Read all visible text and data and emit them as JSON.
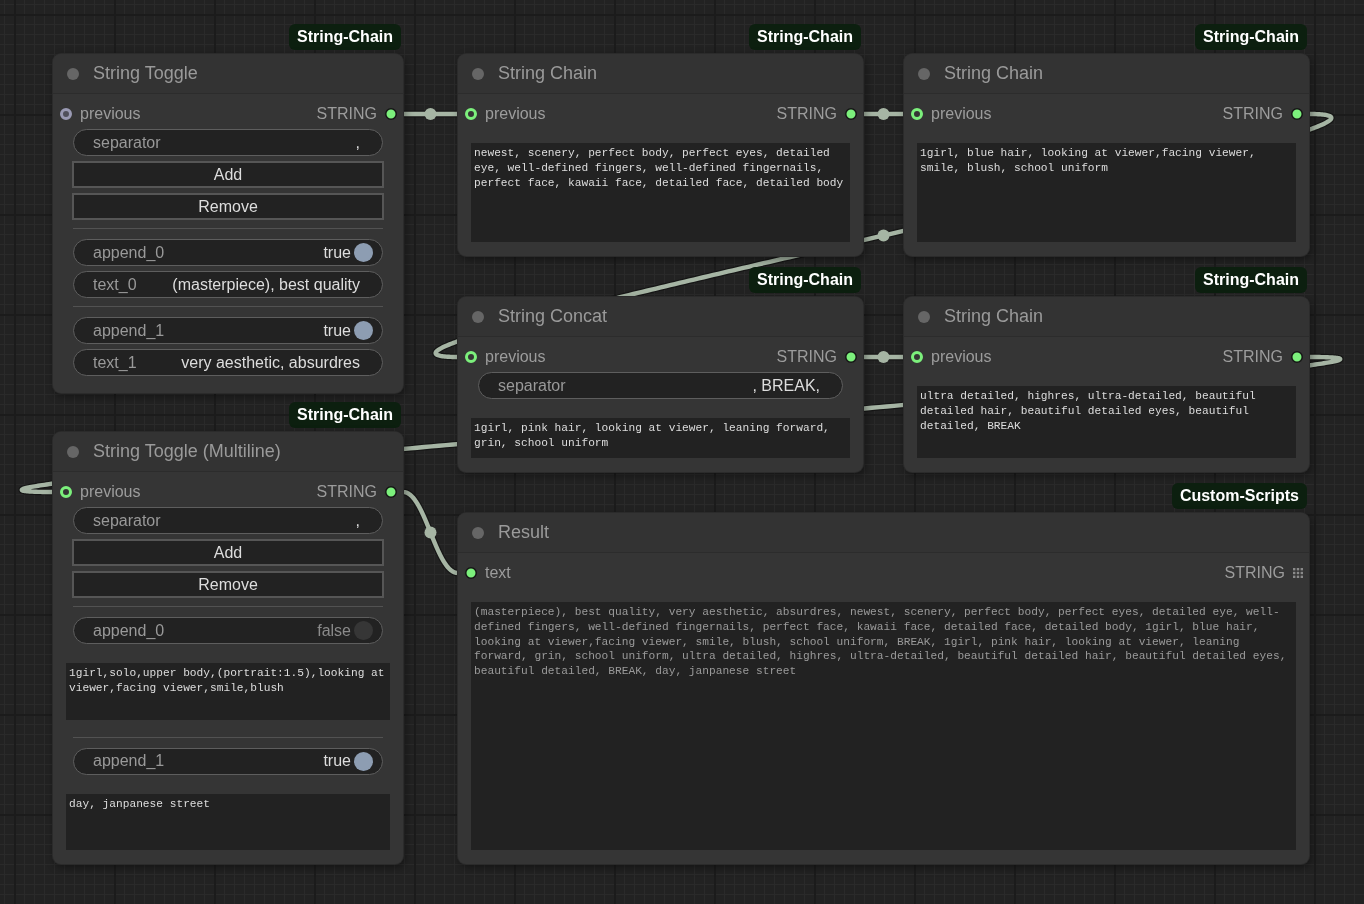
{
  "nodes": [
    {
      "badge": "String-Chain",
      "title": "String Toggle",
      "input": {
        "label": "previous",
        "hollow": true,
        "connected": false
      },
      "output": {
        "label": "STRING",
        "grid": false,
        "connected": true
      },
      "widgets": [
        {
          "kind": "text",
          "label": "separator",
          "value": ","
        },
        {
          "kind": "button",
          "label": "Add"
        },
        {
          "kind": "button",
          "label": "Remove"
        },
        {
          "kind": "divider"
        },
        {
          "kind": "toggle",
          "label": "append_0",
          "value": "true",
          "on": true
        },
        {
          "kind": "text",
          "label": "text_0",
          "value": "(masterpiece), best quality"
        },
        {
          "kind": "divider"
        },
        {
          "kind": "toggle",
          "label": "append_1",
          "value": "true",
          "on": true
        },
        {
          "kind": "text",
          "label": "text_1",
          "value": "very aesthetic, absurdres"
        }
      ]
    },
    {
      "badge": "String-Chain",
      "title": "String Chain",
      "input": {
        "label": "previous",
        "hollow": true,
        "connected": true
      },
      "output": {
        "label": "STRING",
        "grid": false,
        "connected": true
      },
      "widgets": [
        {
          "kind": "textarea",
          "value": "newest, scenery, perfect body, perfect eyes, detailed eye, well-defined fingers, well-defined fingernails, perfect face, kawaii face, detailed face, detailed body",
          "readonly": false
        }
      ]
    },
    {
      "badge": "String-Chain",
      "title": "String Chain",
      "input": {
        "label": "previous",
        "hollow": true,
        "connected": true
      },
      "output": {
        "label": "STRING",
        "grid": false,
        "connected": true
      },
      "widgets": [
        {
          "kind": "textarea",
          "value": "1girl, blue hair, looking at viewer,facing viewer, smile, blush, school uniform",
          "readonly": false
        }
      ]
    },
    {
      "badge": "String-Chain",
      "title": "String Concat",
      "input": {
        "label": "previous",
        "hollow": true,
        "connected": true
      },
      "output": {
        "label": "STRING",
        "grid": false,
        "connected": true
      },
      "widgets": [
        {
          "kind": "text",
          "label": "separator",
          "value": ", BREAK,"
        },
        {
          "kind": "textarea",
          "value": "1girl, pink hair, looking at viewer, leaning forward, grin, school uniform",
          "readonly": false
        }
      ]
    },
    {
      "badge": "String-Chain",
      "title": "String Chain",
      "input": {
        "label": "previous",
        "hollow": true,
        "connected": true
      },
      "output": {
        "label": "STRING",
        "grid": false,
        "connected": true
      },
      "widgets": [
        {
          "kind": "textarea",
          "value": "ultra detailed, highres, ultra-detailed, beautiful detailed hair, beautiful detailed eyes, beautiful detailed, BREAK",
          "readonly": false
        }
      ]
    },
    {
      "badge": "String-Chain",
      "title": "String Toggle (Multiline)",
      "input": {
        "label": "previous",
        "hollow": true,
        "connected": true
      },
      "output": {
        "label": "STRING",
        "grid": false,
        "connected": true
      },
      "widgets": [
        {
          "kind": "text",
          "label": "separator",
          "value": ","
        },
        {
          "kind": "button",
          "label": "Add"
        },
        {
          "kind": "button",
          "label": "Remove"
        },
        {
          "kind": "divider"
        },
        {
          "kind": "toggle",
          "label": "append_0",
          "value": "false",
          "on": false
        },
        {
          "kind": "textarea",
          "value": "1girl,solo,upper body,(portrait:1.5),looking at viewer,facing viewer,smile,blush",
          "readonly": false
        },
        {
          "kind": "divider"
        },
        {
          "kind": "toggle",
          "label": "append_1",
          "value": "true",
          "on": true
        },
        {
          "kind": "textarea",
          "value": "day, janpanese street",
          "readonly": false
        }
      ]
    },
    {
      "badge": "Custom-Scripts",
      "title": "Result",
      "input": {
        "label": "text",
        "hollow": false,
        "connected": true
      },
      "output": {
        "label": "STRING",
        "grid": true,
        "connected": false
      },
      "widgets": [
        {
          "kind": "textarea",
          "value": "(masterpiece), best quality, very aesthetic, absurdres, newest, scenery, perfect body, perfect eyes, detailed eye, well-defined fingers, well-defined fingernails, perfect face, kawaii face, detailed face, detailed body, 1girl, blue hair, looking at viewer,facing viewer, smile, blush, school uniform, BREAK, 1girl, pink hair, looking at viewer, leaning forward, grin, school uniform, ultra detailed, highres, ultra-detailed, beautiful detailed hair, beautiful detailed eyes, beautiful detailed, BREAK, day, janpanese street",
          "readonly": true
        }
      ]
    }
  ]
}
